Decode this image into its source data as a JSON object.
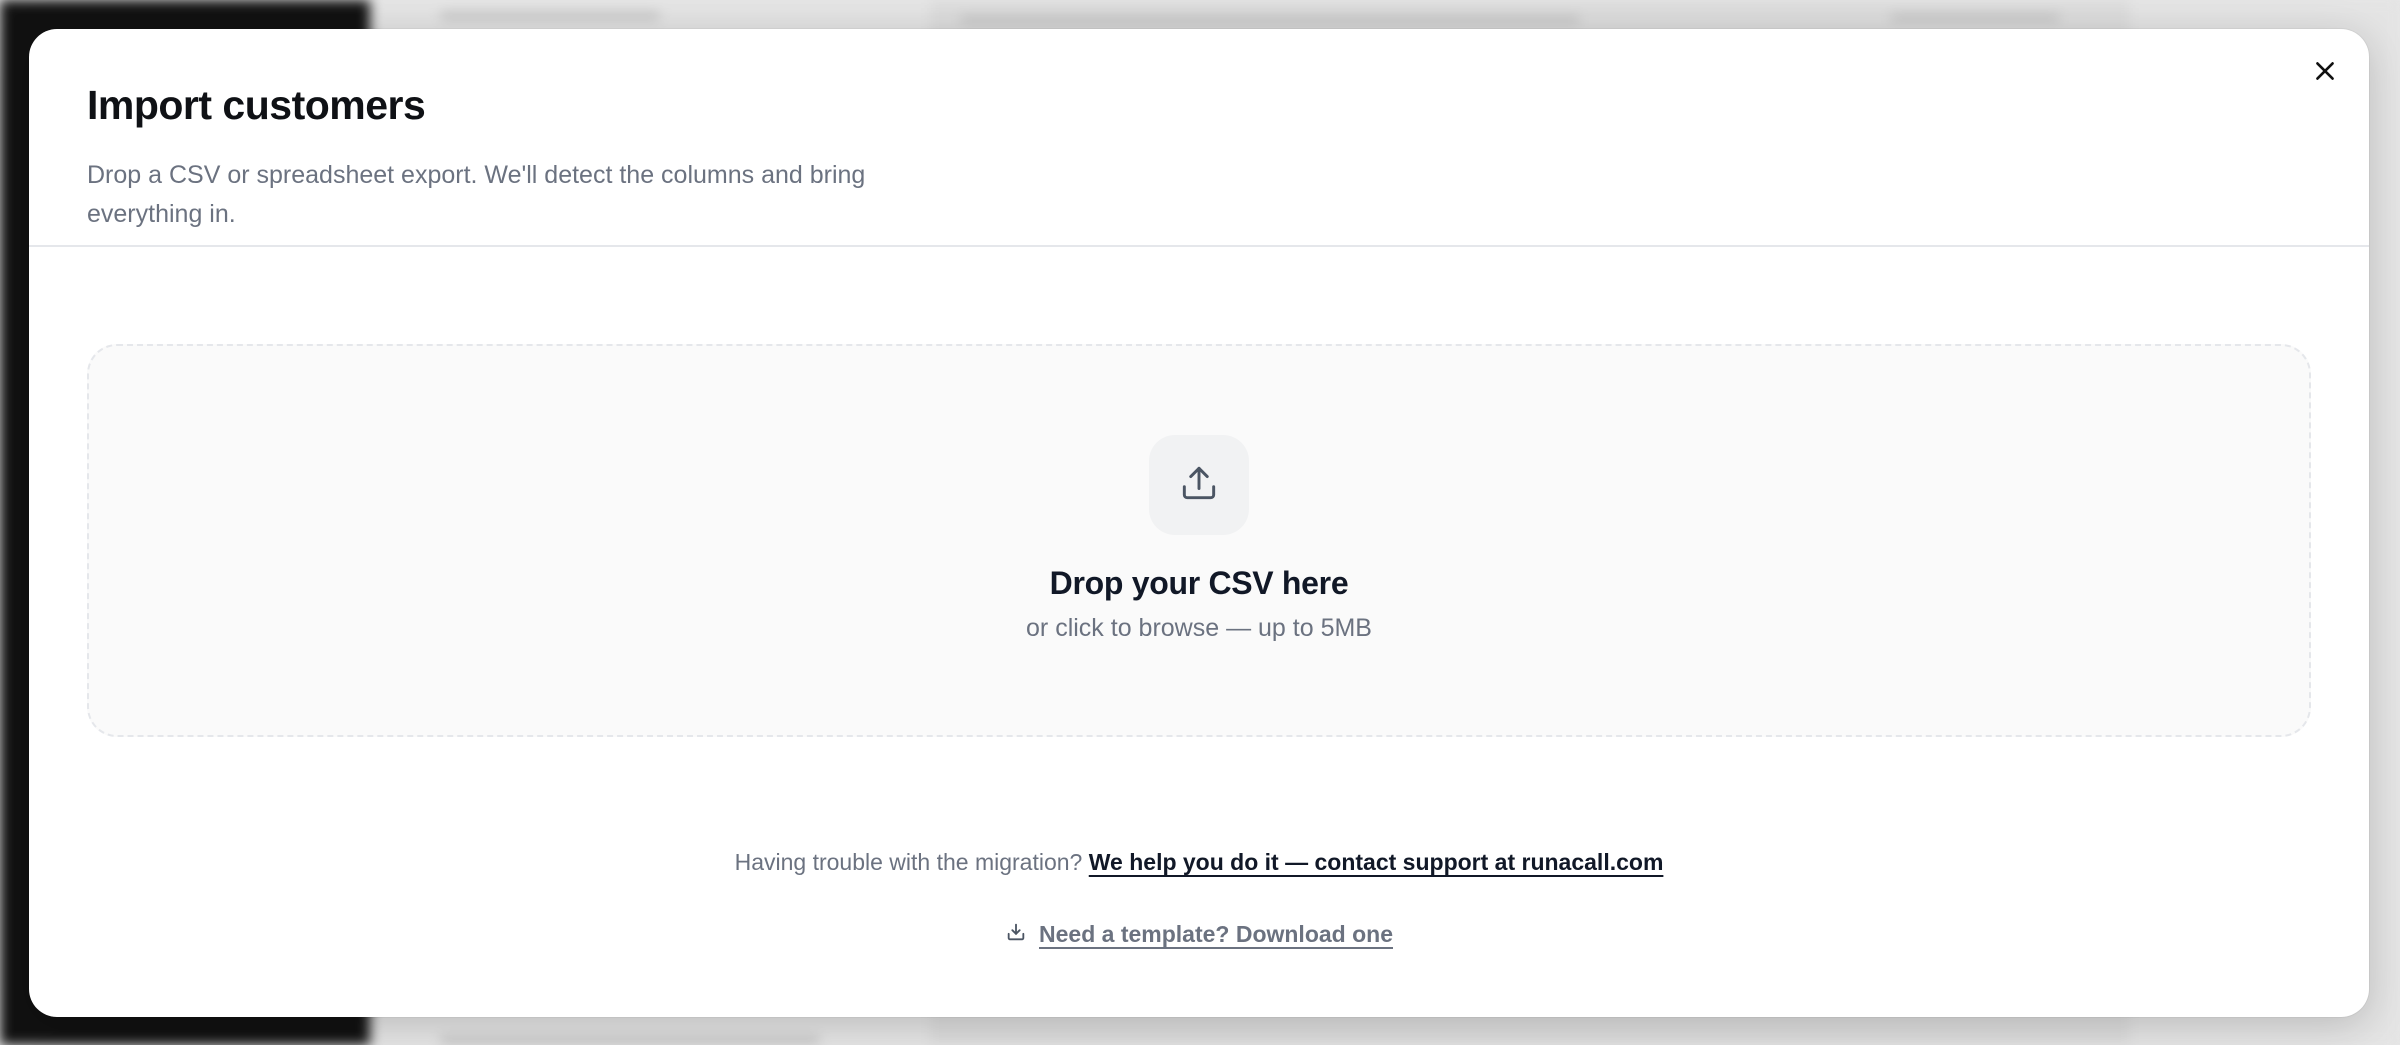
{
  "modal": {
    "title": "Import customers",
    "subtitle": "Drop a CSV or spreadsheet export. We'll detect the columns and bring everything in.",
    "close_icon": "close-icon"
  },
  "dropzone": {
    "icon": "upload-icon",
    "title": "Drop your CSV here",
    "subtitle": "or click to browse — up to 5MB"
  },
  "help": {
    "prompt": "Having trouble with the migration?",
    "link_label": "We help you do it — contact support at runacall.com"
  },
  "template": {
    "icon": "download-icon",
    "link_label": "Need a template? Download one"
  },
  "colors": {
    "overlay_dark": "#111111",
    "modal_bg": "#ffffff",
    "title": "#0f1115",
    "muted_text": "#6b7280",
    "border": "#e5e7eb"
  }
}
